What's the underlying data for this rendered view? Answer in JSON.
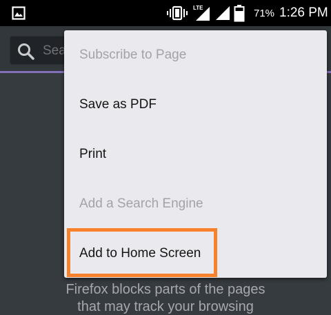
{
  "status_bar": {
    "battery_percent": "71%",
    "time": "1:26 PM",
    "network_label": "LTE",
    "icons": [
      "gallery-icon",
      "vibrate-icon",
      "lte-signal-icon",
      "signal-icon",
      "battery-icon"
    ]
  },
  "toolbar": {
    "search_placeholder": "Sea"
  },
  "menu": {
    "items": [
      {
        "label": "Subscribe to Page",
        "enabled": false
      },
      {
        "label": "Save as PDF",
        "enabled": true
      },
      {
        "label": "Print",
        "enabled": true
      },
      {
        "label": "Add a Search Engine",
        "enabled": false
      },
      {
        "label": "Add to Home Screen",
        "enabled": true,
        "highlighted": true
      }
    ]
  },
  "content": {
    "line1": "Firefox blocks parts of the pages",
    "line2": "that may track your browsing"
  },
  "colors": {
    "accent": "#8270b8",
    "highlight": "#f7822b",
    "menu_background": "#eae9ee",
    "page_background": "#363b40"
  }
}
